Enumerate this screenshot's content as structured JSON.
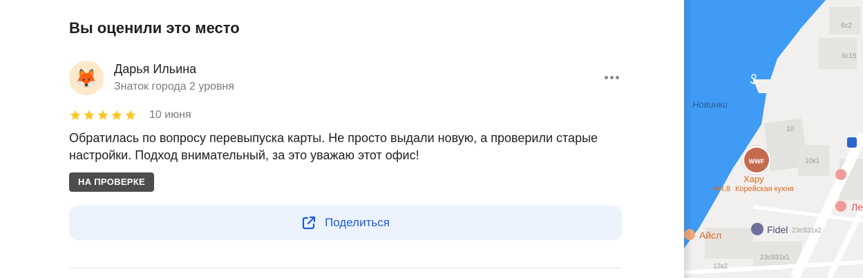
{
  "section": {
    "title": "Вы оценили это место"
  },
  "review": {
    "author_name": "Дарья Ильина",
    "author_status": "Знаток города 2 уровня",
    "avatar_emoji": "🦊",
    "rating": 5,
    "date": "10 июня",
    "text": "Обратилась по вопросу перевыпуска карты. Не просто выдали новую, а проверили старые настройки. Подход внимательный, за это уважаю этот офис!",
    "badge": "НА ПРОВЕРКЕ",
    "share_label": "Поделиться",
    "star_color": "#fbc523"
  },
  "map": {
    "area_label": "Новинки",
    "place_name": "Хару",
    "place_rating": "★4,8",
    "place_category": "Корейская кухня",
    "place_avatar_text": "WWF",
    "poi_aisl": "Айсл",
    "poi_fidel": "Fidel",
    "poi_le": "Ле",
    "buildings": [
      "6с2",
      "6с15",
      "10",
      "10к1",
      "23с931к2",
      "12к2",
      "23с931к1"
    ],
    "water_color": "#3f9bf3",
    "accent_color": "#ea4e4e"
  }
}
